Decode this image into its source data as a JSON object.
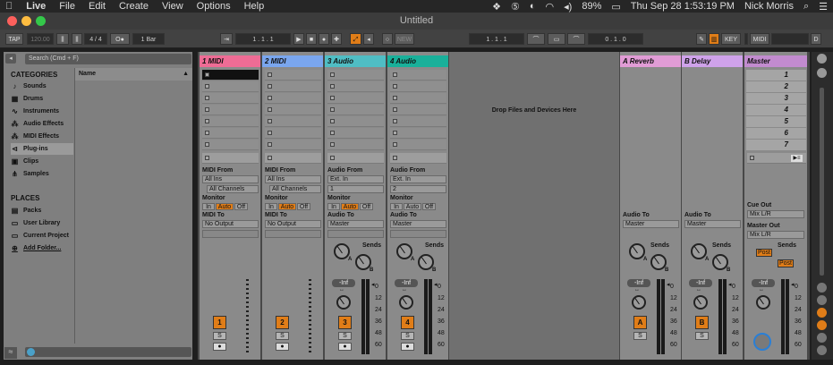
{
  "menubar": {
    "apple": "",
    "app": "Live",
    "items": [
      "File",
      "Edit",
      "Create",
      "View",
      "Options",
      "Help"
    ],
    "battery": "89%",
    "datetime": "Thu Sep 28  1:53:19 PM",
    "user": "Nick Morris"
  },
  "title": "Untitled",
  "transport": {
    "tap": "TAP",
    "bpm": "120.00",
    "sig": "4 / 4",
    "dots": "O●",
    "quant": "1 Bar",
    "pos1": "1 .  1 .  1",
    "pos2": "1 .  1 .  1",
    "pos3": "0 .  1 .  0",
    "new": "NEW",
    "key": "KEY",
    "midi": "MIDI",
    "d": "D"
  },
  "browser": {
    "search": "Search (Cmd + F)",
    "categories_title": "CATEGORIES",
    "name_col": "Name",
    "categories": [
      "Sounds",
      "Drums",
      "Instruments",
      "Audio Effects",
      "MIDI Effects",
      "Plug-ins",
      "Clips",
      "Samples"
    ],
    "places_title": "PLACES",
    "places": [
      "Packs",
      "User Library",
      "Current Project",
      "Add Folder..."
    ]
  },
  "tracks": [
    {
      "name": "1 MIDI",
      "color": "#ee6c95",
      "type": "midi",
      "from_label": "MIDI From",
      "from": "All Ins",
      "chan": "All Channels",
      "to_label": "MIDI To",
      "to": "No Output",
      "num": "1"
    },
    {
      "name": "2 MIDI",
      "color": "#7aa6ee",
      "type": "midi",
      "from_label": "MIDI From",
      "from": "All Ins",
      "chan": "All Channels",
      "to_label": "MIDI To",
      "to": "No Output",
      "num": "2"
    },
    {
      "name": "3 Audio",
      "color": "#4fbdc4",
      "type": "audio",
      "from_label": "Audio From",
      "from": "Ext. In",
      "chan": "1",
      "to_label": "Audio To",
      "to": "Master",
      "num": "3"
    },
    {
      "name": "4 Audio",
      "color": "#19b09a",
      "type": "audio",
      "from_label": "Audio From",
      "from": "Ext. In",
      "chan": "2",
      "to_label": "Audio To",
      "to": "Master",
      "num": "4"
    }
  ],
  "returns": [
    {
      "name": "A Reverb",
      "color": "#e19cd6",
      "to_label": "Audio To",
      "to": "Master",
      "num": "A"
    },
    {
      "name": "B Delay",
      "color": "#cfa2ea",
      "to_label": "Audio To",
      "to": "Master",
      "num": "B"
    }
  ],
  "master": {
    "name": "Master",
    "color": "#c28bcf",
    "scenes": [
      "1",
      "2",
      "3",
      "4",
      "5",
      "6",
      "7"
    ],
    "cue_label": "Cue Out",
    "cue": "Mix L/R",
    "out_label": "Master Out",
    "out": "Mix L/R",
    "post": "Post"
  },
  "mixer": {
    "monitor_label": "Monitor",
    "monitor": [
      "In",
      "Auto",
      "Off"
    ],
    "sends_label": "Sends",
    "vol": "-Inf",
    "scale": [
      "0",
      "12",
      "24",
      "36",
      "48",
      "60"
    ],
    "solo": "S",
    "knobA": "A",
    "knobB": "B"
  },
  "drop_text": "Drop Files and Devices Here"
}
